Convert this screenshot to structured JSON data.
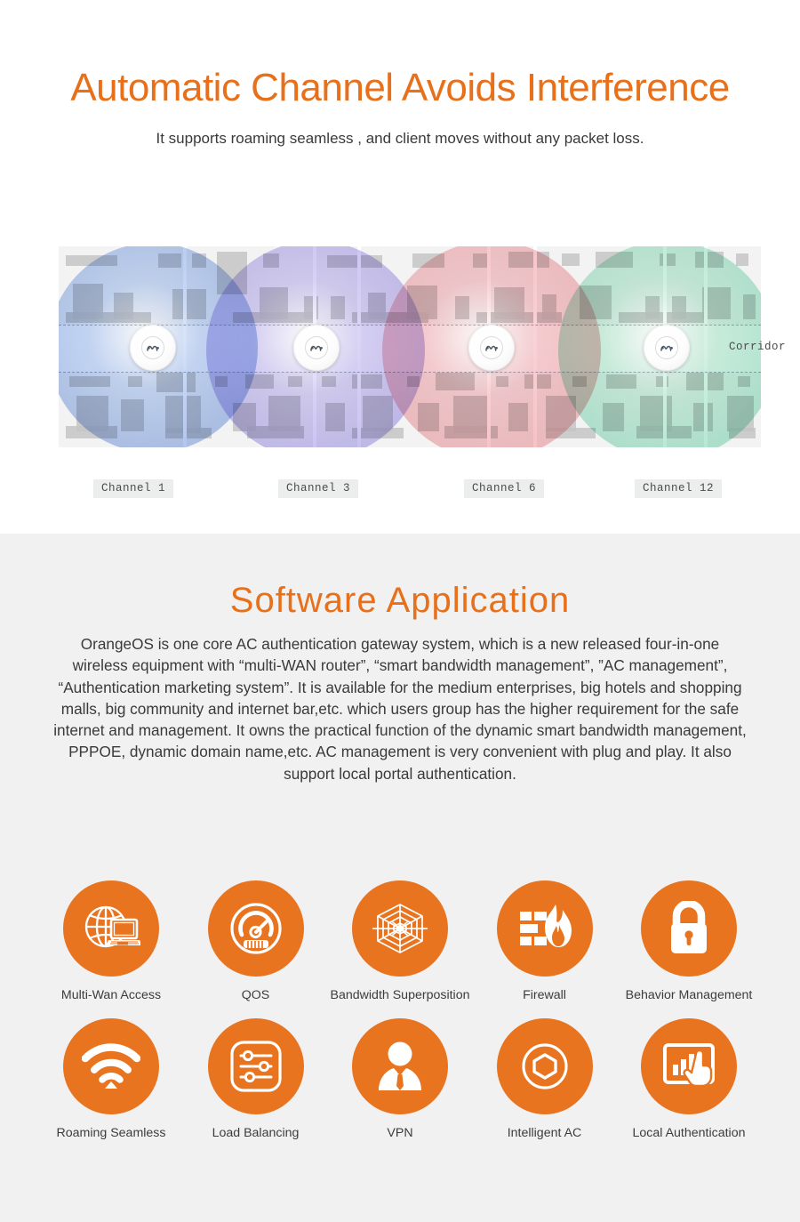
{
  "hero": {
    "title": "Automatic Channel Avoids Interference",
    "subtitle": "It supports roaming seamless , and client moves without any packet loss.",
    "accent_color": "#E8701A"
  },
  "diagram": {
    "corridor_label": "Corridor",
    "access_points": [
      {
        "name": "ap-channel-1",
        "channel_label": "Channel 1",
        "cell_color": "#5b83d6"
      },
      {
        "name": "ap-channel-3",
        "channel_label": "Channel 3",
        "cell_color": "#8a7de0"
      },
      {
        "name": "ap-channel-6",
        "channel_label": "Channel 6",
        "cell_color": "#e98a8f"
      },
      {
        "name": "ap-channel-12",
        "channel_label": "Channel 12",
        "cell_color": "#5fd0a4"
      }
    ],
    "channels": [
      "Channel 1",
      "Channel 3",
      "Channel 6",
      "Channel 12"
    ]
  },
  "software": {
    "title": "Software Application",
    "accent_color": "#E8701A",
    "background_color": "#F1F1F1",
    "paragraph": "OrangeOS is one core AC authentication gateway system, which is a new released four-in-one wireless equipment with “multi-WAN router”, “smart bandwidth management”, ”AC management”, “Authentication marketing system”.\nIt is available for the medium enterprises, big hotels and shopping malls, big community and internet bar,etc. which users group has the higher requirement for the safe internet and management. It owns the practical function of the dynamic smart bandwidth management, PPPOE, dynamic domain name,etc. AC management is very convenient with plug and play. It also support local portal authentication.",
    "icon_circle_color": "#E87420",
    "features_row1": [
      {
        "label": "Multi-Wan Access",
        "icon": "globe-laptop-icon"
      },
      {
        "label": "QOS",
        "icon": "gauge-icon"
      },
      {
        "label": "Bandwidth Superposition",
        "icon": "spider-web-icon"
      },
      {
        "label": "Firewall",
        "icon": "firewall-flame-icon"
      },
      {
        "label": "Behavior Management",
        "icon": "padlock-icon"
      }
    ],
    "features_row2": [
      {
        "label": "Roaming Seamless",
        "icon": "wifi-signal-icon"
      },
      {
        "label": "Load Balancing",
        "icon": "sliders-icon"
      },
      {
        "label": "VPN",
        "icon": "person-tie-icon"
      },
      {
        "label": "Intelligent AC",
        "icon": "hexagon-circle-icon"
      },
      {
        "label": "Local Authentication",
        "icon": "touch-chart-icon"
      }
    ]
  }
}
